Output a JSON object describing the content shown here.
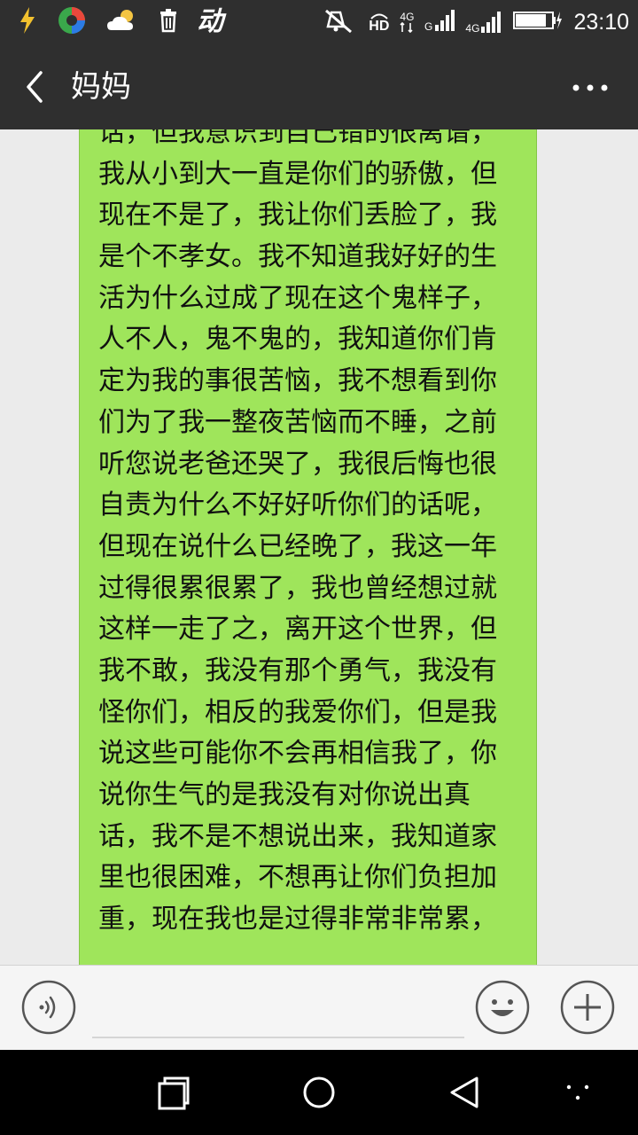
{
  "status_bar": {
    "time": "23:10",
    "network_1": "4G",
    "network_2": "4G",
    "hd_label": "HD",
    "left_icons": [
      "flash-icon",
      "app-icon",
      "weather-icon",
      "trash-icon",
      "dong-icon"
    ],
    "dong_glyph": "动"
  },
  "header": {
    "title": "妈妈",
    "back_icon": "back-arrow-icon",
    "more_icon": "more-icon"
  },
  "message": {
    "direction": "sent",
    "bubble_color": "#9fe55b",
    "lines": [
      "话，但我意识到自己错的很离谱，",
      "我从小到大一直是你们的骄傲，但",
      "现在不是了，我让你们丢脸了，我",
      "是个不孝女。我不知道我好好的生",
      "活为什么过成了现在这个鬼样子，",
      "人不人，鬼不鬼的，我知道你们肯",
      "定为我的事很苦恼，我不想看到你",
      "们为了我一整夜苦恼而不睡，之前",
      "听您说老爸还哭了，我很后悔也很",
      "自责为什么不好好听你们的话呢，",
      "但现在说什么已经晚了，我这一年",
      "过得很累很累了，我也曾经想过就",
      "这样一走了之，离开这个世界，但",
      "我不敢，我没有那个勇气，我没有",
      "怪你们，相反的我爱你们，但是我",
      "说这些可能你不会再相信我了，你",
      "说你生气的是我没有对你说出真",
      "话，我不是不想说出来，我知道家",
      "里也很困难，不想再让你们负担加",
      "重，现在我也是过得非常非常累，"
    ]
  },
  "input_bar": {
    "input_value": "",
    "voice_icon": "voice-icon",
    "emoji_icon": "emoji-icon",
    "plus_icon": "plus-icon"
  },
  "nav_bar": {
    "icons": [
      "recent-apps-icon",
      "home-icon",
      "back-icon",
      "menu-icon"
    ]
  }
}
